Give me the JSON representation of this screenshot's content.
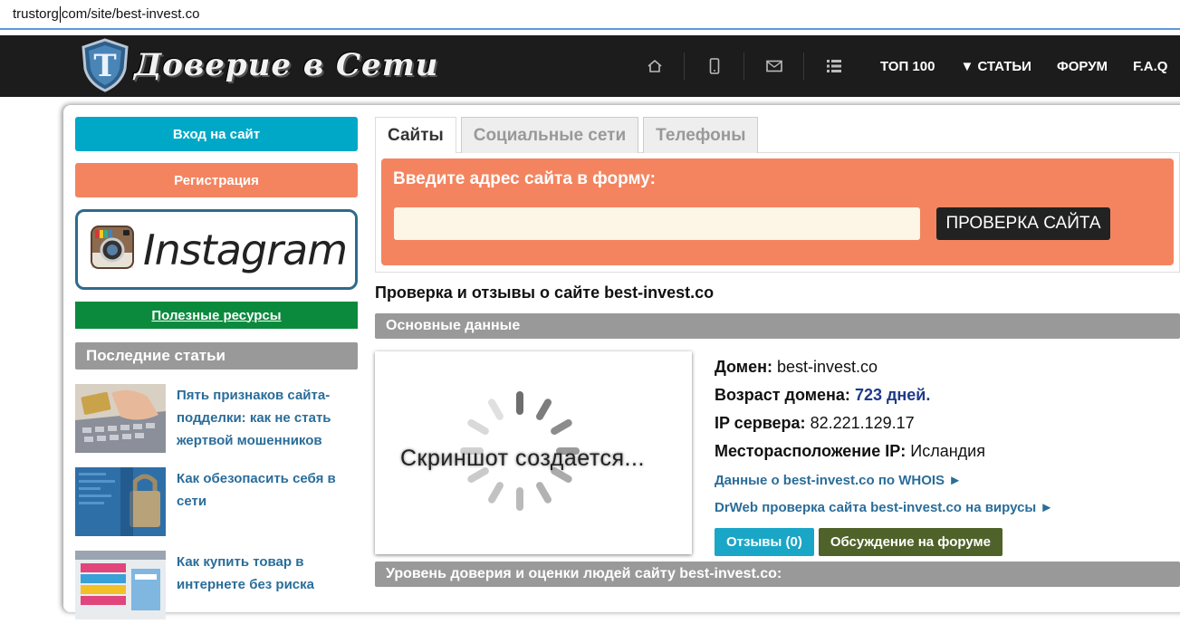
{
  "browser": {
    "url_before_caret": "trustorg",
    "url_after_caret": "com/site/best-invest.co"
  },
  "header": {
    "logo_text": "Доверие в Сети",
    "logo_letter": "T",
    "nav_links": [
      "ТОП 100",
      "▼ СТАТЬИ",
      "ФОРУМ",
      "F.A.Q"
    ]
  },
  "sidebar": {
    "login_label": "Вход на сайт",
    "register_label": "Регистрация",
    "instagram_label": "Instagram",
    "useful_label": "Полезные ресурсы",
    "latest_heading": "Последние статьи",
    "articles": [
      {
        "title": "Пять признаков сайта-подделки: как не стать жертвой мошенников"
      },
      {
        "title": "Как обезопасить себя в сети"
      },
      {
        "title": "Как купить товар в интернете без риска"
      }
    ]
  },
  "main": {
    "tabs": [
      {
        "label": "Сайты",
        "active": true
      },
      {
        "label": "Социальные сети",
        "active": false
      },
      {
        "label": "Телефоны",
        "active": false
      }
    ],
    "form_label": "Введите адрес сайта в форму:",
    "input_value": "",
    "check_button": "ПРОВЕРКА САЙТА",
    "page_heading": "Проверка и отзывы о сайте best-invest.co",
    "section_main": "Основные данные",
    "screenshot_caption": "Скриншот создается...",
    "facts": {
      "domain_label": "Домен:",
      "domain_value": "best-invest.co",
      "age_label": "Возраст домена:",
      "age_value": "723 дней.",
      "ip_label": "IP сервера:",
      "ip_value": "82.221.129.17",
      "location_label": "Месторасположение IP:",
      "location_value": "Исландия"
    },
    "whois_link": "Данные о best-invest.co по WHOIS ►",
    "drweb_link": "DrWeb проверка сайта best-invest.co на вирусы ►",
    "reviews_button": "Отзывы (0)",
    "forum_button": "Обсуждение на форуме",
    "section_trust": "Уровень доверия и оценки людей сайту best-invest.co:"
  },
  "colors": {
    "accent_cyan": "#00a8c8",
    "accent_orange": "#f4845f",
    "green": "#0b8a3e",
    "olive": "#4f6229",
    "link": "#2a6d99",
    "dark_nav": "#1c1c1c"
  }
}
